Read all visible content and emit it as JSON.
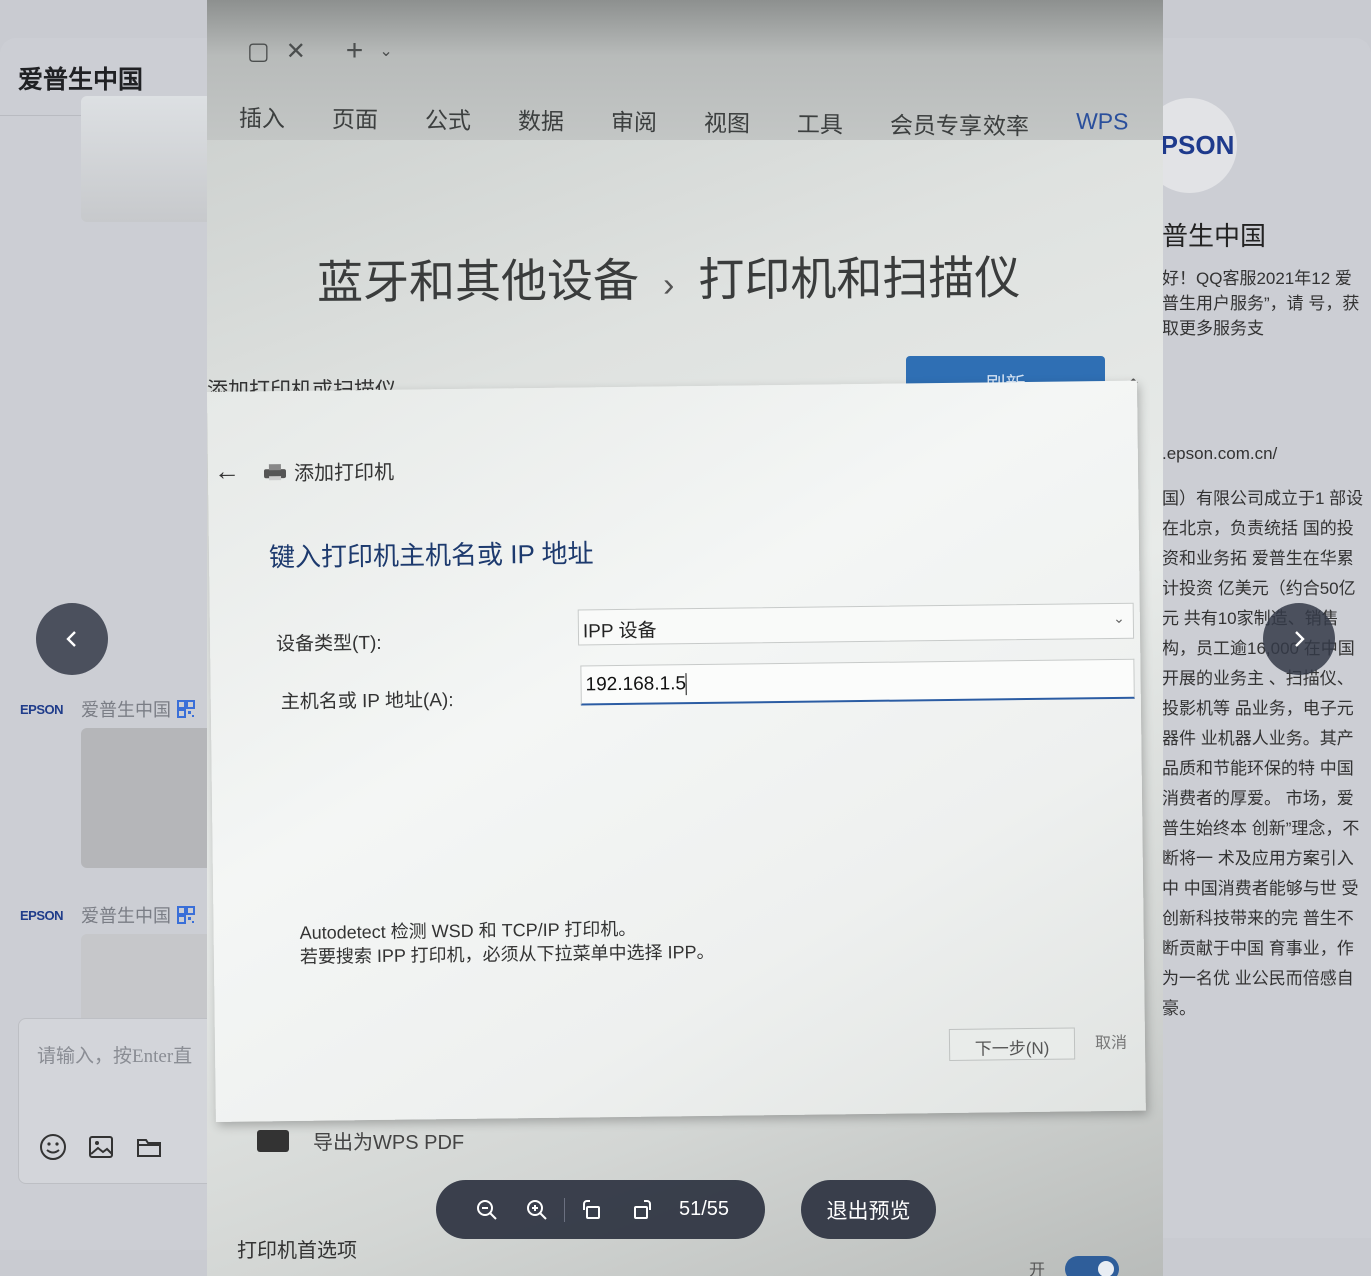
{
  "app": {
    "left_title": "爱普生中国",
    "messages": [
      {
        "logo": "EPSON",
        "sender": "爱普生中国"
      },
      {
        "logo": "EPSON",
        "sender": "爱普生中国"
      }
    ],
    "input_placeholder": "请输入，按Enter直",
    "right": {
      "badge": "PSON",
      "name": "普生中国",
      "intro": "好！QQ客服2021年12 爱普生用户服务”，请 号，获取更多服务支",
      "url": ".epson.com.cn/",
      "description": "国）有限公司成立于1 部设在北京，负责统括 国的投资和业务拓 爱普生在华累计投资 亿美元（约合50亿元 共有10家制造、销售 构，员工逾16,000 在中国开展的业务主 、扫描仪、投影机等 品业务，电子元器件 业机器人业务。其产 品质和节能环保的特 中国消费者的厚爱。 市场，爱普生始终本 创新”理念，不断将一 术及应用方案引入中 中国消费者能够与世 受创新科技带来的完 普生不断贡献于中国 育事业，作为一名优 业公民而倍感自豪。"
    }
  },
  "photo": {
    "wps_menu": [
      "插入",
      "页面",
      "公式",
      "数据",
      "审阅",
      "视图",
      "工具",
      "会员专享",
      "效率",
      "WPS"
    ],
    "settings_breadcrumb_parent": "蓝牙和其他设备",
    "settings_breadcrumb_sep": "›",
    "settings_breadcrumb_current": "打印机和扫描仪",
    "add_printer_or_scanner": "添加打印机或扫描仪",
    "refresh": "刷新",
    "dialog": {
      "title": "添加打印机",
      "heading": "键入打印机主机名或 IP 地址",
      "device_type_label": "设备类型(T):",
      "device_type_value": "IPP 设备",
      "host_label": "主机名或 IP 地址(A):",
      "host_value": "192.168.1.5",
      "note_line1": "Autodetect 检测 WSD 和 TCP/IP 打印机。",
      "note_line2": "若要搜索 IPP 打印机，必须从下拉菜单中选择 IPP。",
      "next": "下一步(N)",
      "cancel": "取消"
    },
    "export_wps_pdf": "导出为WPS PDF",
    "printer_prefs": "打印机首选项",
    "toggle_label": "开"
  },
  "viewer": {
    "page_counter": "51/55",
    "exit_preview": "退出预览"
  },
  "colors": {
    "overlay_control": "#2d3240",
    "epson_blue": "#1e3a8c",
    "refresh_blue": "#2f6fb4"
  }
}
